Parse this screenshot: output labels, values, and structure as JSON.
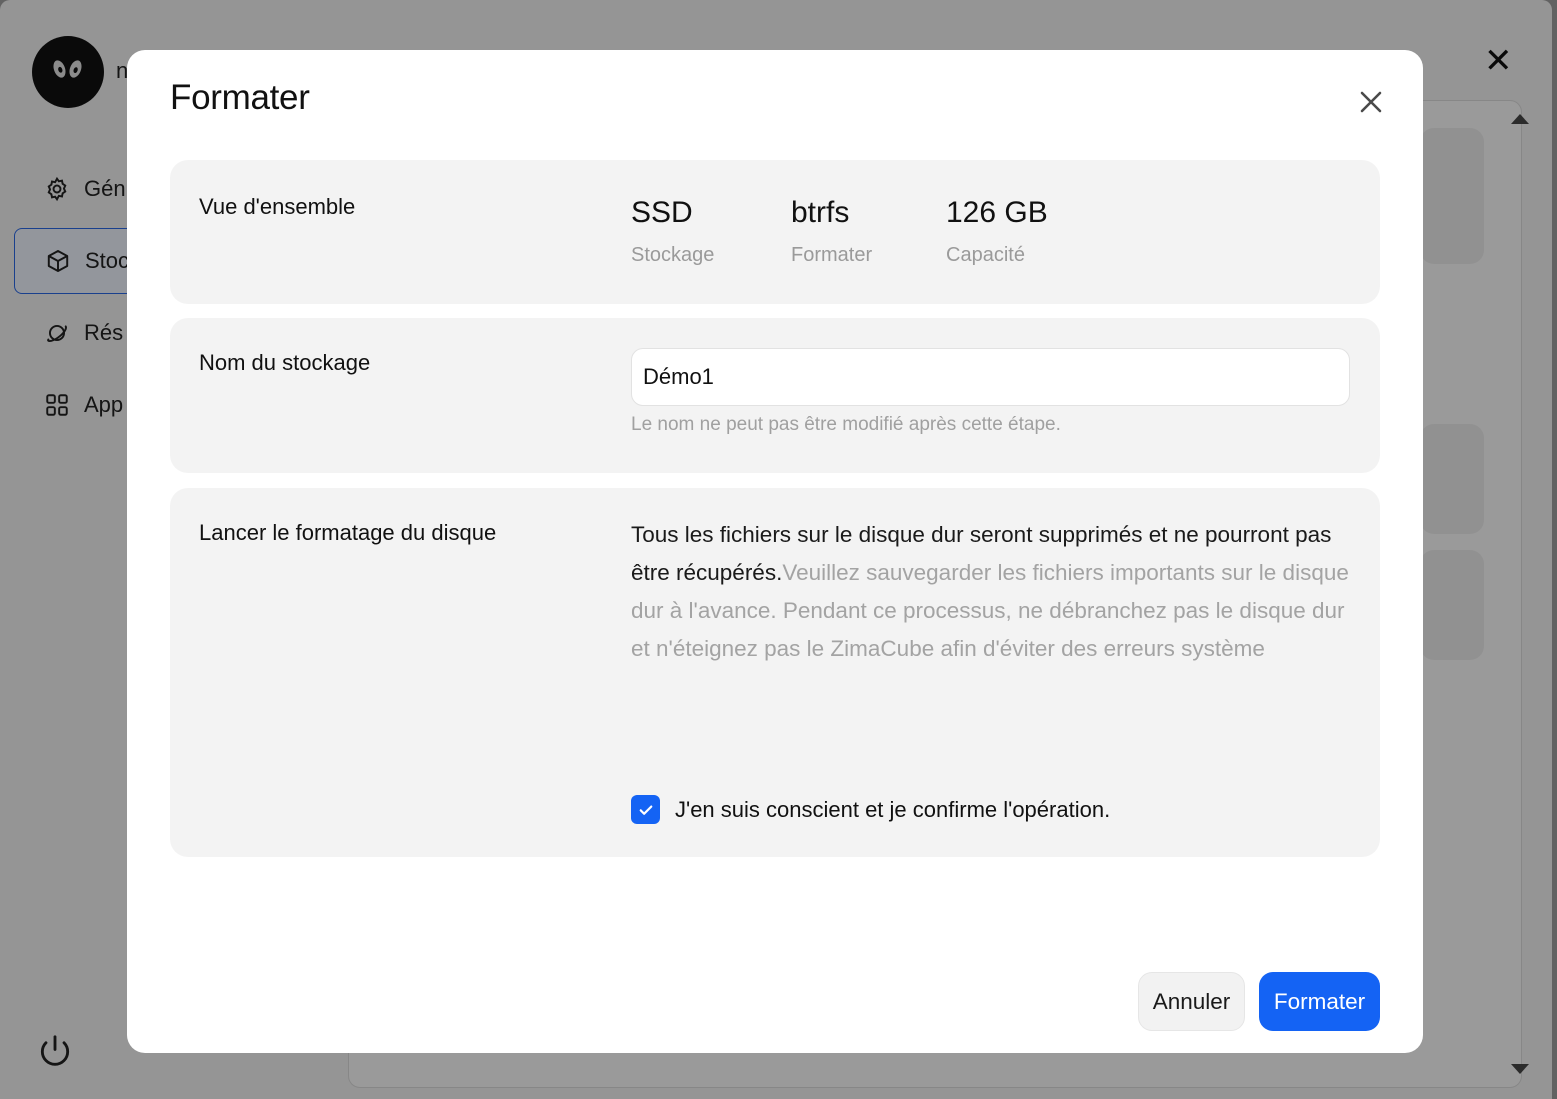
{
  "background": {
    "user_initial": "n",
    "sidebar": [
      {
        "label": "Gén",
        "icon": "gear-icon"
      },
      {
        "label": "Stoc",
        "icon": "cube-icon"
      },
      {
        "label": "Rés",
        "icon": "planet-icon"
      },
      {
        "label": "App",
        "icon": "apps-grid-icon"
      }
    ],
    "close_glyph": "✕"
  },
  "modal": {
    "title": "Formater",
    "overview": {
      "label": "Vue d'ensemble",
      "stats": [
        {
          "value": "SSD",
          "key": "Stockage"
        },
        {
          "value": "btrfs",
          "key": "Formater"
        },
        {
          "value": "126 GB",
          "key": "Capacité"
        }
      ]
    },
    "storage_name": {
      "label": "Nom du stockage",
      "value": "Démo1",
      "hint": "Le nom ne peut pas être modifié après cette étape."
    },
    "format": {
      "label": "Lancer le formatage du disque",
      "warning_strong": "Tous les fichiers sur le disque dur seront supprimés et ne pourront pas être récupérés.",
      "warning_rest": "Veuillez sauvegarder les fichiers importants sur le disque dur à l'avance. Pendant ce processus, ne débranchez pas le disque dur et n'éteignez pas le ZimaCube afin d'éviter des erreurs système",
      "confirm_checked": true,
      "confirm_label": "J'en suis conscient et je confirme l'opération."
    },
    "buttons": {
      "cancel": "Annuler",
      "submit": "Formater"
    }
  },
  "colors": {
    "primary": "#1463f4",
    "section_bg": "#f3f3f3",
    "muted_text": "#a3a3a3"
  }
}
